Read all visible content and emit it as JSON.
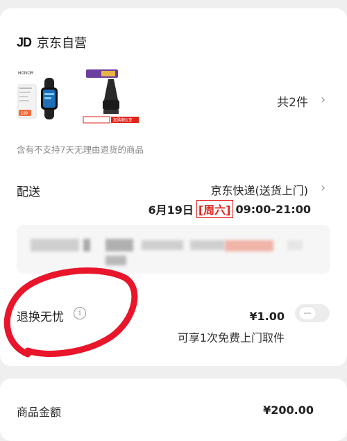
{
  "shop": {
    "logo": "JD",
    "name": "京东自营"
  },
  "products": [
    {
      "name": "honor-band",
      "brand": "HONOR",
      "price_tag": "199"
    },
    {
      "name": "nose-trimmer-head",
      "promo_tag": "加购物1支"
    }
  ],
  "item_count": "共2件",
  "notice": "含有不支持7天无理由退货的商品",
  "shipping": {
    "label": "配送",
    "method": "京东快递(送货上门)",
    "date": "6月19日",
    "weekday": "[周六]",
    "time": "09:00-21:00"
  },
  "service": {
    "label": "退换无忧",
    "price": "¥1.00",
    "desc": "可享1次免费上门取件",
    "enabled": false
  },
  "summary": {
    "label": "商品金额",
    "value": "¥200.00"
  },
  "colors": {
    "accent_red": "#e2231a",
    "annotation": "#e8152b"
  }
}
